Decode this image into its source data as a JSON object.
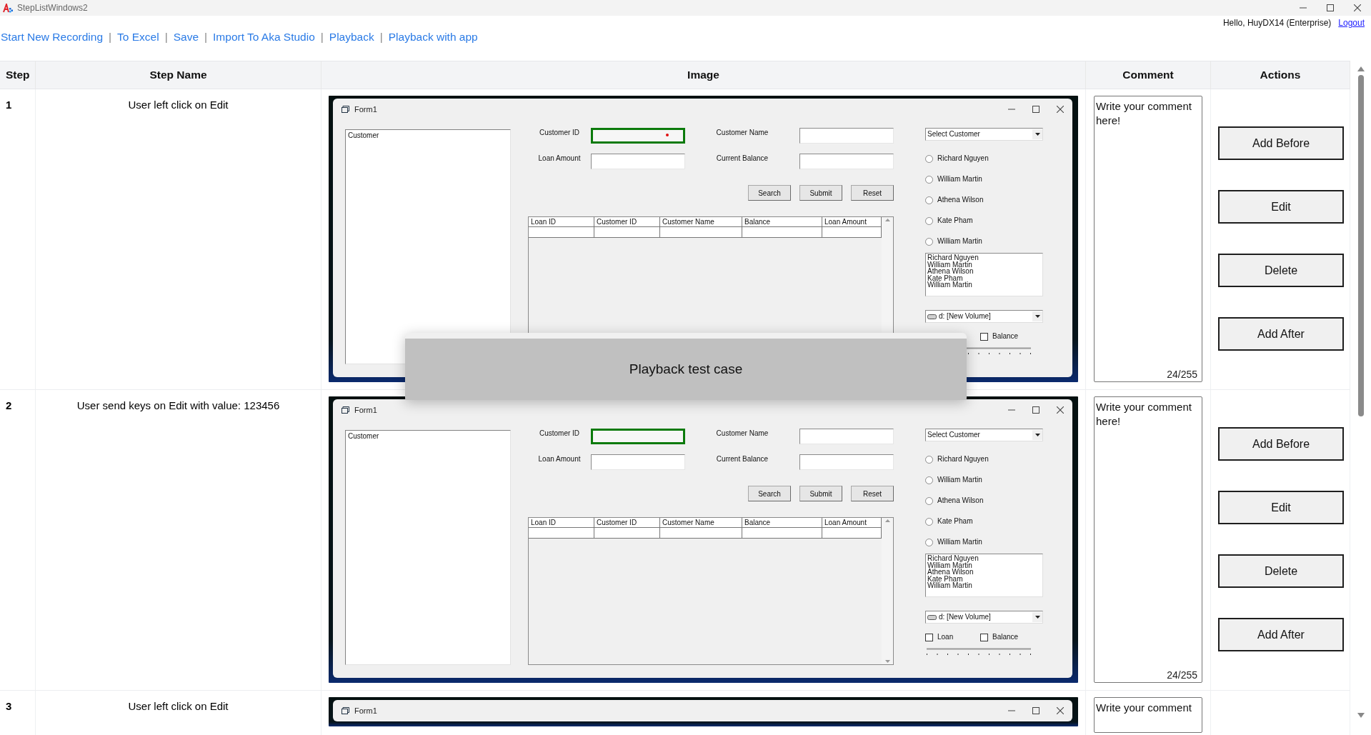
{
  "window": {
    "title": "StepListWindows2"
  },
  "toolbar": {
    "links": [
      "Start New Recording",
      "To Excel",
      "Save",
      "Import To Aka Studio",
      "Playback",
      "Playback with app"
    ],
    "separator": "|"
  },
  "user": {
    "greeting": "Hello, HuyDX14 (Enterprise)",
    "logout": "Logout"
  },
  "table": {
    "columns": [
      "Step",
      "Step Name",
      "Image",
      "Comment",
      "Actions"
    ],
    "rows": [
      {
        "step": "1",
        "name": "User left click on Edit",
        "image": {
          "title": "Form1",
          "list_header": "Customer",
          "fields": [
            {
              "label": "Customer ID",
              "highlighted": true
            },
            {
              "label": "Customer Name",
              "highlighted": false
            },
            {
              "label": "Loan Amount",
              "highlighted": false
            },
            {
              "label": "Current Balance",
              "highlighted": false
            }
          ],
          "click_marker": true,
          "buttons": [
            "Search",
            "Submit",
            "Reset"
          ],
          "grid_columns": [
            "Loan ID",
            "Customer ID",
            "Customer Name",
            "Balance",
            "Loan Amount"
          ],
          "combo": "Select Customer",
          "radios": [
            {
              "label": "Richard Nguyen",
              "selected": false
            },
            {
              "label": "William Martin",
              "selected": false
            },
            {
              "label": "Athena Wilson",
              "selected": false
            },
            {
              "label": "Kate Pham",
              "selected": false
            },
            {
              "label": "William Martin",
              "selected": false
            }
          ],
          "list_items": [
            "Richard Nguyen",
            "William Martin",
            "Athena Wilson",
            "Kate Pham",
            "William Martin"
          ],
          "drive": "d: [New Volume]",
          "checkboxes": [
            {
              "label": "Balance",
              "checked": false
            }
          ]
        },
        "comment": {
          "placeholder": "Write your comment here!",
          "counter": "24/255"
        },
        "actions": [
          "Add Before",
          "Edit",
          "Delete",
          "Add After"
        ]
      },
      {
        "step": "2",
        "name": "User send keys on Edit with value: 123456",
        "image": {
          "title": "Form1",
          "list_header": "Customer",
          "fields": [
            {
              "label": "Customer ID",
              "highlighted": true
            },
            {
              "label": "Customer Name",
              "highlighted": false
            },
            {
              "label": "Loan Amount",
              "highlighted": false
            },
            {
              "label": "Current Balance",
              "highlighted": false
            }
          ],
          "click_marker": false,
          "buttons": [
            "Search",
            "Submit",
            "Reset"
          ],
          "grid_columns": [
            "Loan ID",
            "Customer ID",
            "Customer Name",
            "Balance",
            "Loan Amount"
          ],
          "combo": "Select Customer",
          "radios": [
            {
              "label": "Richard Nguyen",
              "selected": false
            },
            {
              "label": "William Martin",
              "selected": false
            },
            {
              "label": "Athena Wilson",
              "selected": false
            },
            {
              "label": "Kate Pham",
              "selected": false
            },
            {
              "label": "William Martin",
              "selected": false
            }
          ],
          "list_items": [
            "Richard Nguyen",
            "William Martin",
            "Athena Wilson",
            "Kate Pham",
            "William Martin"
          ],
          "drive": "d: [New Volume]",
          "checkboxes": [
            {
              "label": "Loan",
              "checked": false
            },
            {
              "label": "Balance",
              "checked": false
            }
          ]
        },
        "comment": {
          "placeholder": "Write your comment here!",
          "counter": "24/255"
        },
        "actions": [
          "Add Before",
          "Edit",
          "Delete",
          "Add After"
        ]
      },
      {
        "step": "3",
        "name": "User left click on Edit",
        "image": {
          "title": "Form1"
        },
        "comment": {
          "placeholder": "Write your comment"
        }
      }
    ]
  },
  "overlay": {
    "message": "Playback test case"
  }
}
